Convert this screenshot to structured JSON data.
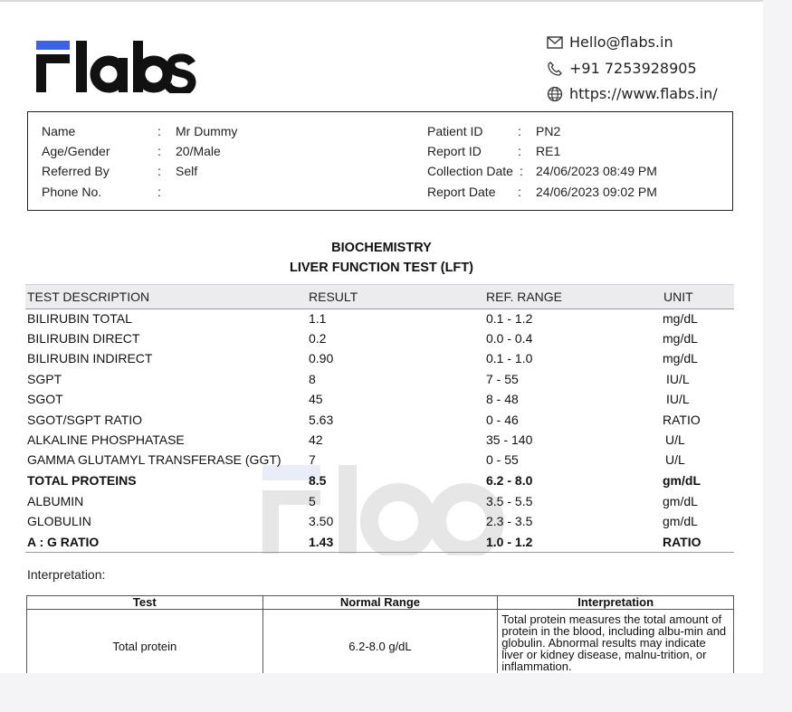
{
  "brand": {
    "logo_text": "Flabs",
    "accent_color": "#3d63e0"
  },
  "contact": {
    "email": "Hello@flabs.in",
    "phone": "+91 7253928905",
    "website": "https://www.flabs.in/"
  },
  "patient": {
    "name_label": "Name",
    "name": "Mr Dummy",
    "age_gender_label": "Age/Gender",
    "age_gender": "20/Male",
    "referred_by_label": "Referred By",
    "referred_by": "Self",
    "phone_label": "Phone No.",
    "phone": "",
    "patient_id_label": "Patient ID",
    "patient_id": "PN2",
    "report_id_label": "Report ID",
    "report_id": "RE1",
    "collection_date_label": "Collection Date",
    "collection_date": "24/06/2023 08:49 PM",
    "report_date_label": "Report Date",
    "report_date": "24/06/2023 09:02 PM"
  },
  "report": {
    "department": "BIOCHEMISTRY",
    "test_name": "LIVER FUNCTION TEST (LFT)",
    "columns": [
      "TEST DESCRIPTION",
      "RESULT",
      "REF. RANGE",
      "UNIT"
    ],
    "rows": [
      {
        "test": "BILIRUBIN TOTAL",
        "result": "1.1",
        "range": "0.1 - 1.2",
        "unit": "mg/dL",
        "bold": false
      },
      {
        "test": "BILIRUBIN DIRECT",
        "result": "0.2",
        "range": "0.0 - 0.4",
        "unit": "mg/dL",
        "bold": false
      },
      {
        "test": "BILIRUBIN INDIRECT",
        "result": "0.90",
        "range": "0.1 - 1.0",
        "unit": "mg/dL",
        "bold": false
      },
      {
        "test": "SGPT",
        "result": "8",
        "range": "7 - 55",
        "unit": "IU/L",
        "bold": false
      },
      {
        "test": "SGOT",
        "result": "45",
        "range": "8 - 48",
        "unit": "IU/L",
        "bold": false
      },
      {
        "test": "SGOT/SGPT RATIO",
        "result": "5.63",
        "range": "0 - 46",
        "unit": "RATIO",
        "bold": false
      },
      {
        "test": "ALKALINE PHOSPHATASE",
        "result": "42",
        "range": "35 - 140",
        "unit": "U/L",
        "bold": false
      },
      {
        "test": "GAMMA GLUTAMYL TRANSFERASE (GGT)",
        "result": "7",
        "range": "0 - 55",
        "unit": "U/L",
        "bold": false
      },
      {
        "test": "TOTAL PROTEINS",
        "result": "8.5",
        "range": "6.2 - 8.0",
        "unit": "gm/dL",
        "bold": true
      },
      {
        "test": "ALBUMIN",
        "result": "5",
        "range": "3.5 - 5.5",
        "unit": "gm/dL",
        "bold": false
      },
      {
        "test": "GLOBULIN",
        "result": "3.50",
        "range": "2.3 - 3.5",
        "unit": "gm/dL",
        "bold": false
      },
      {
        "test": "A : G RATIO",
        "result": "1.43",
        "range": "1.0 - 1.2",
        "unit": "RATIO",
        "bold": true
      }
    ]
  },
  "interpretation": {
    "label": "Interpretation:",
    "columns": [
      "Test",
      "Normal Range",
      "Interpretation"
    ],
    "rows": [
      {
        "test": "Total protein",
        "range": "6.2-8.0 g/dL",
        "text": "Total protein measures the total amount of protein in the blood, including albu-min and globulin. Abnormal results may indicate liver or kidney disease, malnu-trition, or inflammation."
      }
    ]
  }
}
